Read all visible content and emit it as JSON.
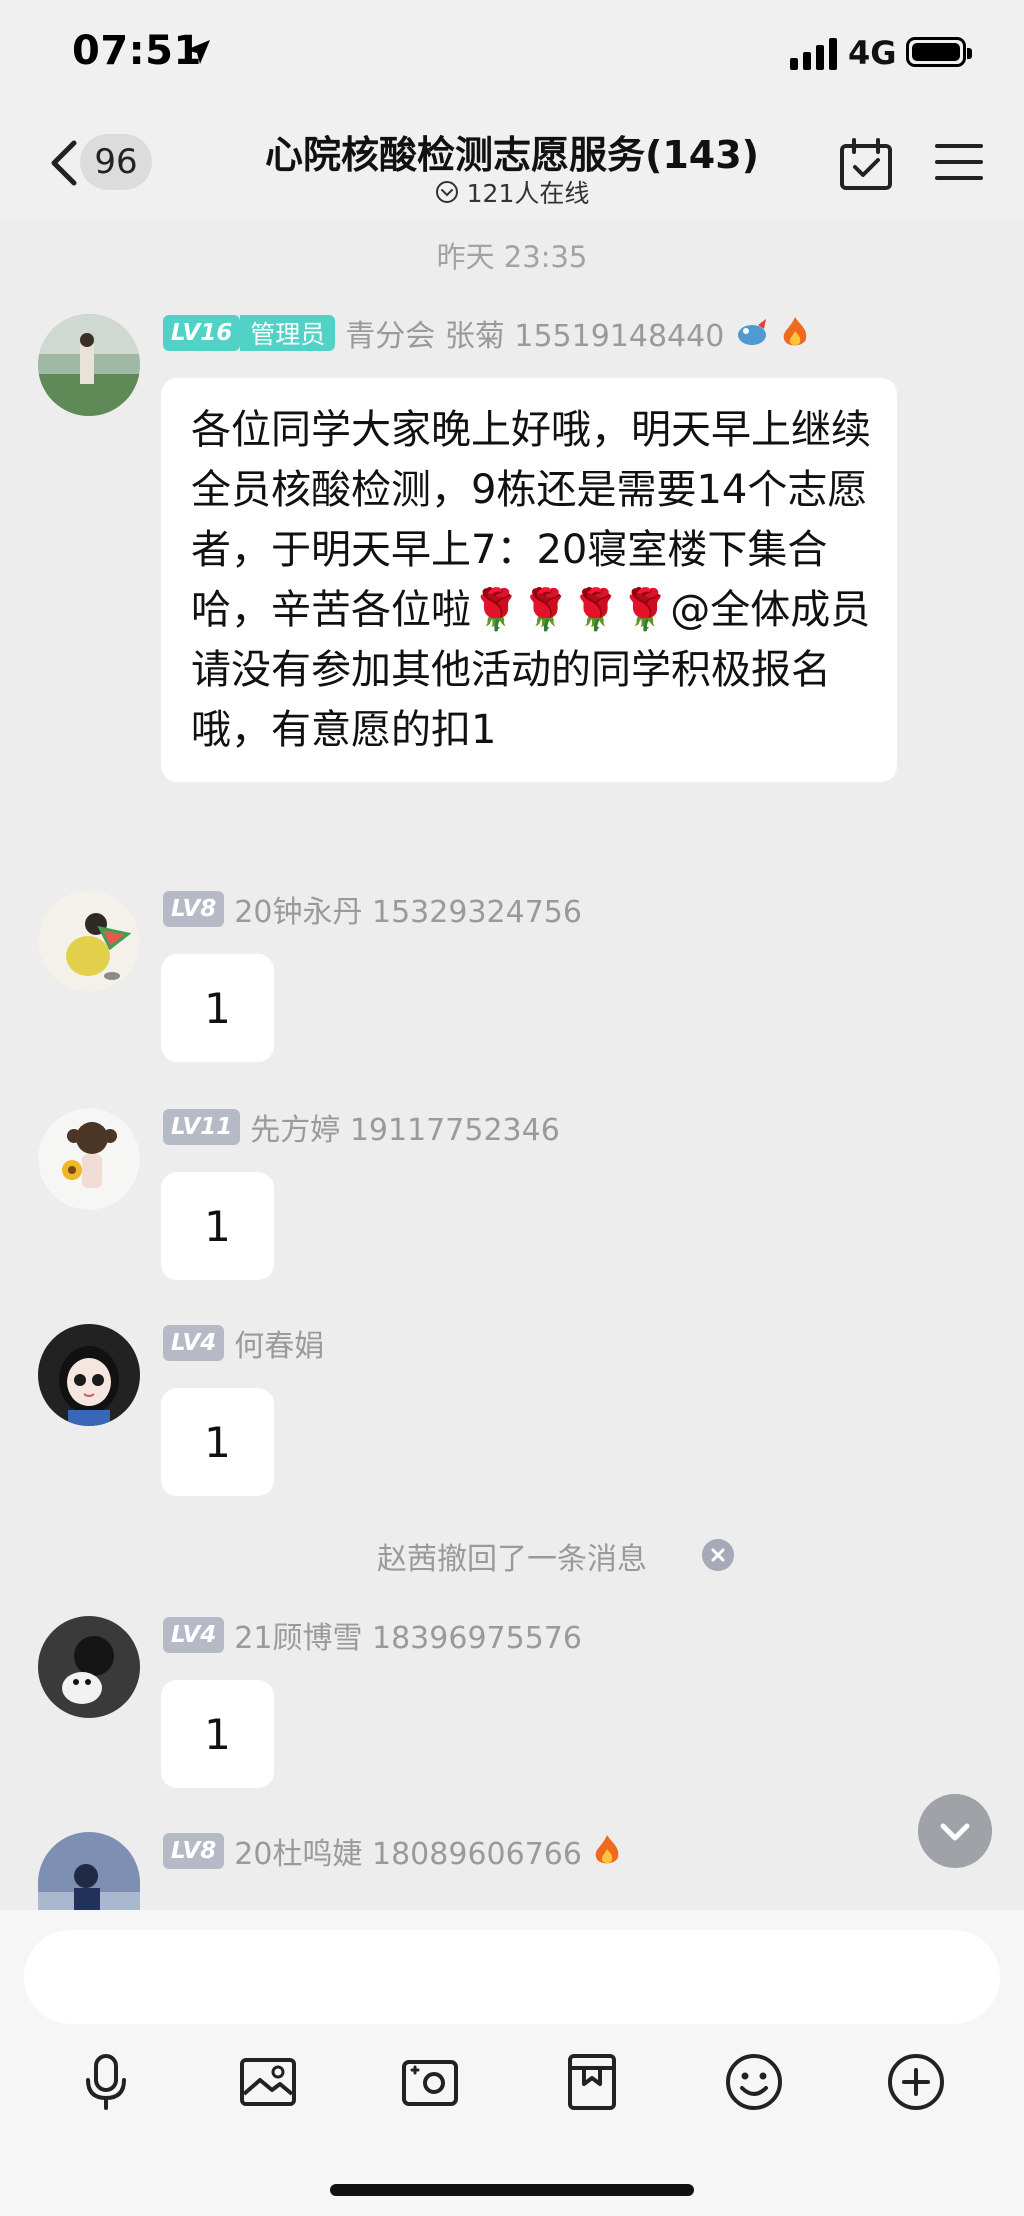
{
  "status_bar": {
    "time": "07:51",
    "network": "4G"
  },
  "nav": {
    "back_count": "96",
    "title": "心院核酸检测志愿服务(143)",
    "online_text": "121人在线"
  },
  "chat": {
    "timestamp": "昨天 23:35",
    "messages": [
      {
        "level": "LV16",
        "role": "管理员",
        "sender": "青分会 张菊 15519148440",
        "text": "各位同学大家晚上好哦，明天早上继续全员核酸检测，9栋还是需要14个志愿者，于明天早上7：20寝室楼下集合哈，辛苦各位啦🌹🌹🌹🌹@全体成员 请没有参加其他活动的同学积极报名哦，有意愿的扣1"
      },
      {
        "level": "LV8",
        "sender": "20钟永丹 15329324756",
        "text": "1"
      },
      {
        "level": "LV11",
        "sender": "先方婷 19117752346",
        "text": "1"
      },
      {
        "level": "LV4",
        "sender": "何春娟",
        "text": "1"
      },
      {
        "level": "LV4",
        "sender": "21顾博雪 18396975576",
        "text": "1"
      },
      {
        "level": "LV8",
        "sender": "20杜鸣婕 18089606766",
        "text": ""
      }
    ],
    "recall_notice": "赵茜撤回了一条消息"
  },
  "input": {
    "placeholder": ""
  },
  "toolbar": [
    "mic-icon",
    "image-icon",
    "camera-icon",
    "file-icon",
    "emoji-icon",
    "plus-icon"
  ]
}
